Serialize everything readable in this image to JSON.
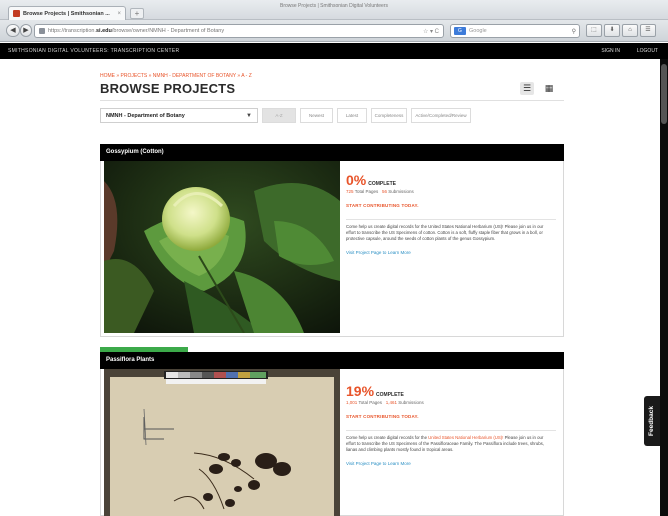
{
  "browser": {
    "window_title": "Browse Projects | Smithsonian Digital Volunteers",
    "tab_label": "Browse Projects | Smithsonian ...",
    "tab_close": "×",
    "new_tab": "+",
    "url_prefix": "https://transcription.",
    "url_host": "si.edu",
    "url_path": "/browse/owner/NMNH - Department of Botany",
    "url_icons": "☆ ▾ C",
    "search_engine": "Google",
    "back": "◀",
    "forward": "▶",
    "tools": [
      "⬚",
      "⬇",
      "⌂",
      "☰"
    ]
  },
  "site": {
    "name": "SMITHSONIAN DIGITAL VOLUNTEERS: TRANSCRIPTION CENTER",
    "signin": "SIGN IN",
    "logout": "LOGOUT"
  },
  "page": {
    "breadcrumb": "HOME » PROJECTS » NMNH - DEPARTMENT OF BOTANY » A - Z",
    "title": "BROWSE PROJECTS",
    "list_view": "☰",
    "grid_view": "▦"
  },
  "filters": {
    "selected": "NMNH - Department of Botany",
    "caret": "▼",
    "buttons": [
      "A-Z",
      "Newest",
      "Latest",
      "Completeness",
      "Active/Completed/Review"
    ]
  },
  "projects": [
    {
      "title": "Gossypium (Cotton)",
      "percent": "0%",
      "complete_label": "COMPLETE",
      "pages_count": "725",
      "pages_label": "Total Pages",
      "subs_count": "56",
      "subs_label": "Submissions",
      "cta": "START CONTRIBUTING TODAY.",
      "description": "Come help us create digital records for the United States National Herbarium (US)! Please join us in our effort to transcribe the US Specimens of cotton. Cotton is a soft, fluffy staple fiber that grows in a boll, or protective capsule, around the seeds of cotton plants of the genus Gossypium.",
      "link": "Visit Project Page to Learn More"
    },
    {
      "title": "Passiflora Plants",
      "percent": "19%",
      "complete_label": "COMPLETE",
      "pages_count": "1,001",
      "pages_label": "Total Pages",
      "subs_count": "1,461",
      "subs_label": "Submissions",
      "cta": "START CONTRIBUTING TODAY.",
      "desc_part1": "Come help us create digital records for the ",
      "desc_highlight": "United States National Herbarium (US)!",
      "desc_part2": " Please join us in our effort to transcribe the US Specimens of the Passifloraceae Family. The Passiflora include trees, shrubs, lianas and climbing plants mostly found in tropical areas.",
      "link": "Visit Project Page to Learn More"
    }
  ],
  "feedback": "Feedback",
  "colors": {
    "accent": "#e8542a",
    "link": "#2a8fc4",
    "progress": "#3caa4a",
    "header_bg": "#000000"
  }
}
